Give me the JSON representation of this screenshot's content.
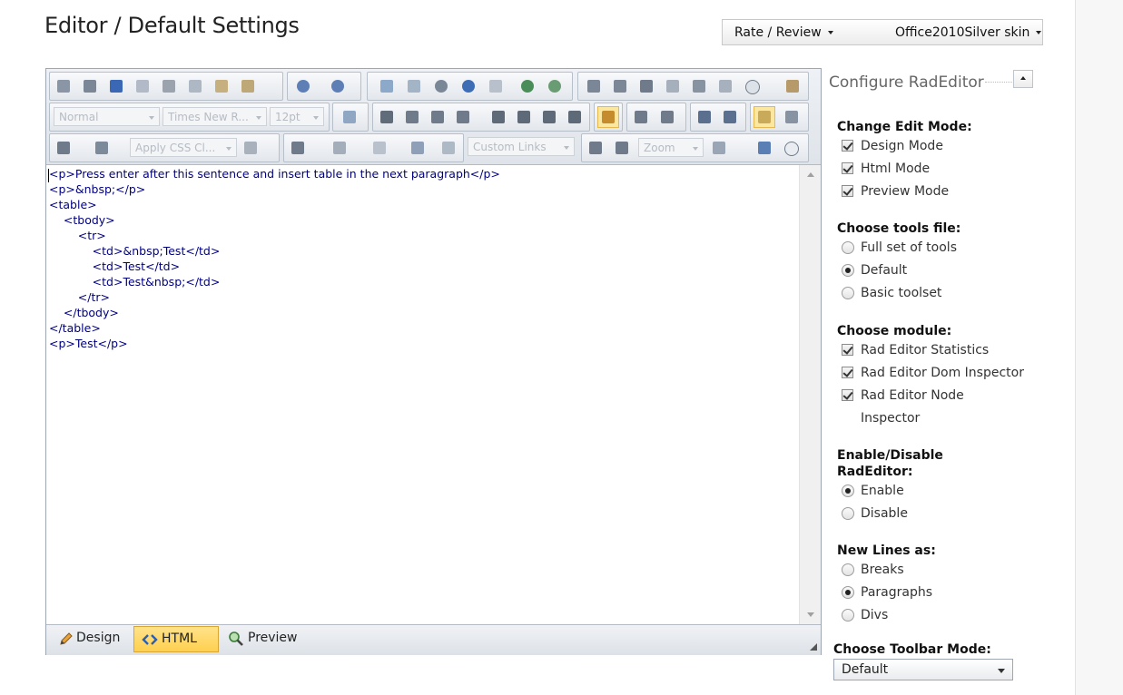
{
  "page": {
    "title": "Editor / Default Settings"
  },
  "topbar": {
    "rate_review": "Rate / Review",
    "skin": "Office2010Silver skin"
  },
  "toolbar": {
    "paragraph_style": "Normal",
    "font_name": "Times New R...",
    "font_size": "12pt",
    "css_class": "Apply CSS Cl...",
    "custom_links": "Custom Links",
    "zoom": "Zoom"
  },
  "code": {
    "lines": [
      "<p>Press enter after this sentence and insert table in the next paragraph</p>",
      "<p>&nbsp;</p>",
      "<table>",
      "    <tbody>",
      "        <tr>",
      "            <td>&nbsp;Test</td>",
      "            <td>Test</td>",
      "            <td>Test&nbsp;</td>",
      "        </tr>",
      "    </tbody>",
      "</table>",
      "<p>Test</p>"
    ]
  },
  "modes": {
    "design": "Design",
    "html": "HTML",
    "preview": "Preview",
    "active": "HTML"
  },
  "config": {
    "title": "Configure RadEditor",
    "edit_mode": {
      "title": "Change Edit Mode:",
      "design": "Design Mode",
      "html": "Html Mode",
      "preview": "Preview Mode",
      "checked": [
        "Design Mode",
        "Html Mode",
        "Preview Mode"
      ]
    },
    "tools_file": {
      "title": "Choose tools file:",
      "full": "Full set of tools",
      "default": "Default",
      "basic": "Basic toolset",
      "selected": "Default"
    },
    "module": {
      "title": "Choose module:",
      "stats": "Rad Editor Statistics",
      "dom": "Rad Editor Dom Inspector",
      "node_1": "Rad Editor Node",
      "node_2": "Inspector",
      "checked": [
        "Rad Editor Statistics",
        "Rad Editor Dom Inspector",
        "Rad Editor Node Inspector"
      ]
    },
    "enable": {
      "title_1": "Enable/Disable",
      "title_2": "RadEditor:",
      "enable": "Enable",
      "disable": "Disable",
      "selected": "Enable"
    },
    "newlines": {
      "title": "New Lines as:",
      "breaks": "Breaks",
      "paragraphs": "Paragraphs",
      "divs": "Divs",
      "selected": "Paragraphs"
    },
    "toolbar_mode": {
      "title": "Choose Toolbar Mode:",
      "value": "Default"
    }
  },
  "colors": {
    "code_text": "#000080",
    "active_tab": "#ffd04f",
    "toolbar_bg": "#e3e7ec"
  }
}
